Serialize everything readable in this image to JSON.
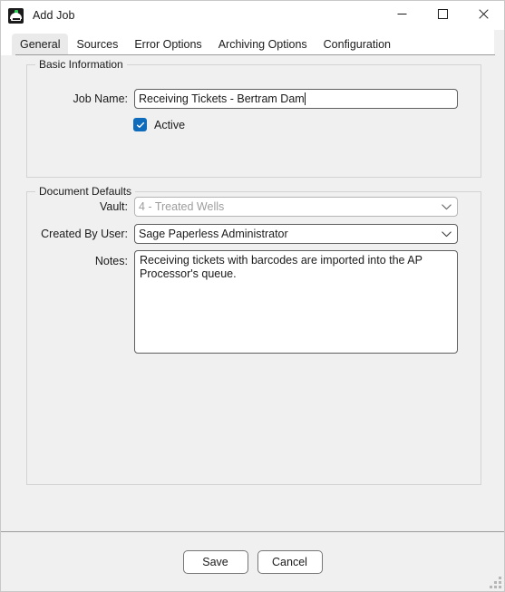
{
  "window": {
    "title": "Add Job",
    "icon": "sage-paperless-icon",
    "controls": {
      "minimize": "minimize-icon",
      "maximize": "maximize-icon",
      "close": "close-icon"
    }
  },
  "tabs": [
    {
      "label": "General",
      "active": true
    },
    {
      "label": "Sources",
      "active": false
    },
    {
      "label": "Error Options",
      "active": false
    },
    {
      "label": "Archiving Options",
      "active": false
    },
    {
      "label": "Configuration",
      "active": false
    }
  ],
  "basic_information": {
    "group_title": "Basic Information",
    "job_name": {
      "label": "Job Name:",
      "value": "Receiving Tickets - Bertram Dam",
      "placeholder": "",
      "focused": true
    },
    "active": {
      "label": "Active",
      "checked": true
    }
  },
  "document_defaults": {
    "group_title": "Document Defaults",
    "vault": {
      "label": "Vault:",
      "value": "4 - Treated Wells",
      "disabled": true,
      "chevron": "chevron-down-icon"
    },
    "created_by_user": {
      "label": "Created By User:",
      "value": "Sage Paperless  Administrator",
      "disabled": false,
      "chevron": "chevron-down-icon"
    },
    "notes": {
      "label": "Notes:",
      "value": "Receiving tickets with barcodes are imported into the AP Processor's queue.",
      "placeholder": ""
    }
  },
  "footer": {
    "save_label": "Save",
    "cancel_label": "Cancel",
    "resize_grip": "resize-grip-icon"
  },
  "colors": {
    "window_background": "#f0f0f0",
    "titlebar_background": "#ffffff",
    "accent_checkbox": "#0f6cbd",
    "active_tab_background": "#eaeaea",
    "control_border": "#5e5e5e",
    "disabled_text": "#9d9d9d",
    "group_border": "#d3d3d3"
  }
}
